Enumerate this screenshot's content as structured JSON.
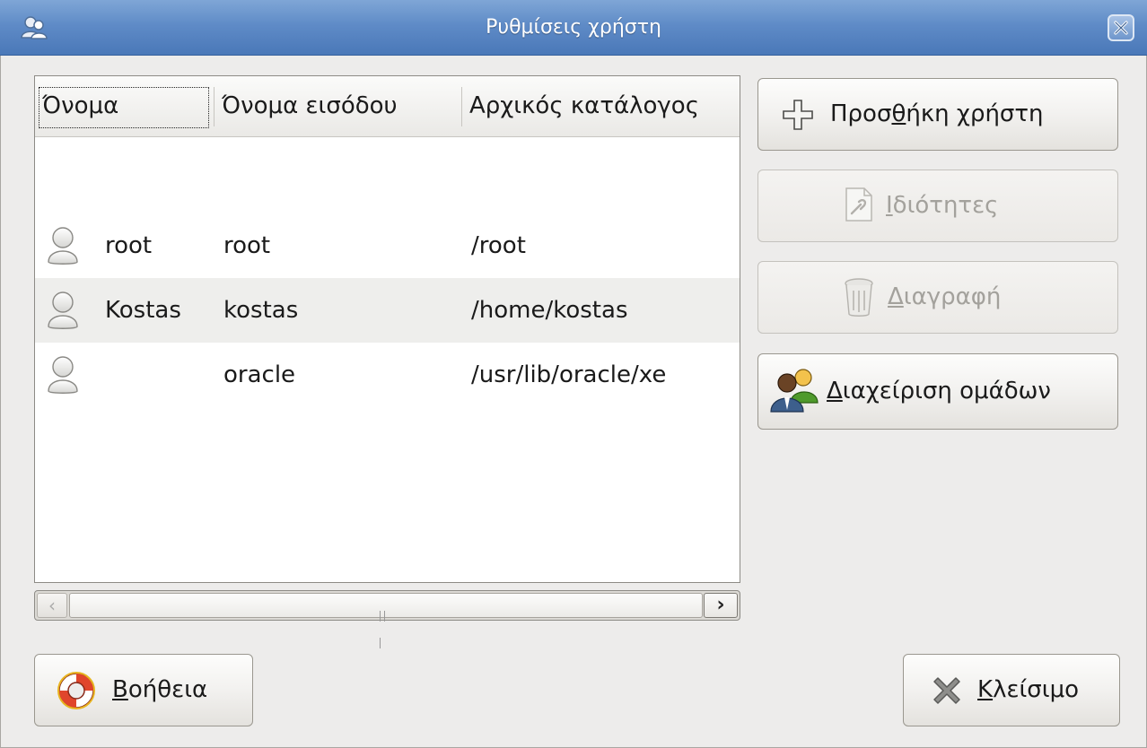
{
  "window": {
    "title": "Ρυθμίσεις χρήστη"
  },
  "icons": {
    "title": "users-icon",
    "close": "close-icon",
    "user": "user-icon",
    "add": "plus-icon",
    "properties": "properties-icon",
    "delete": "trash-icon",
    "groups": "group-icon",
    "help": "lifebuoy-icon",
    "closeBtn": "x-icon"
  },
  "list": {
    "columns": [
      "Όνομα",
      "Όνομα εισόδου",
      "Αρχικός κατάλογος"
    ],
    "rows": [
      {
        "name": "root",
        "login": "root",
        "home": "/root"
      },
      {
        "name": "Kostas",
        "login": "kostas",
        "home": "/home/kostas"
      },
      {
        "name": "",
        "login": "oracle",
        "home": "/usr/lib/oracle/xe"
      }
    ]
  },
  "buttons": {
    "add_mn": "Προσ",
    "add_u": "θ",
    "add_rest": "ήκη χρήστη",
    "props_u": "Ι",
    "props_rest": "διότητες",
    "delete_u": "Δ",
    "delete_rest": "ιαγραφή",
    "groups_u": "Δ",
    "groups_rest": "ιαχείριση ομάδων",
    "help_u": "Β",
    "help_rest": "οήθεια",
    "close_u": "Κ",
    "close_rest": "λείσιμο"
  },
  "colors": {
    "titlebar": "#5f8bc7",
    "selection_alt_row": "#eeeeec",
    "disabled_text": "#a3a19c"
  }
}
